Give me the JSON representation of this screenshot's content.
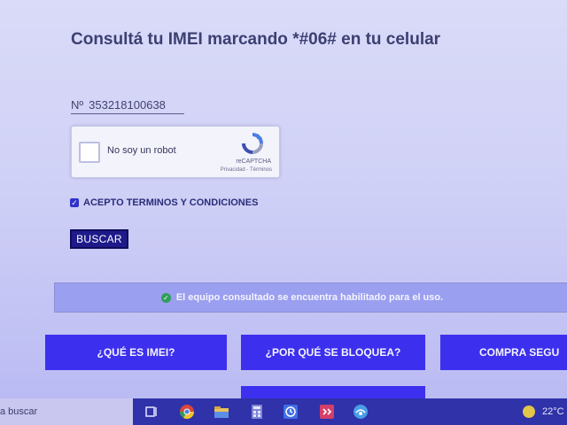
{
  "page": {
    "title": "Consultá tu IMEI marcando *#06# en tu celular"
  },
  "imei": {
    "prefix": "Nº",
    "value": "353218100638"
  },
  "captcha": {
    "label": "No soy un robot",
    "brand": "reCAPTCHA",
    "links": "Privacidad - Términos"
  },
  "terms": {
    "checked": true,
    "label": "ACEPTO TERMINOS Y CONDICIONES"
  },
  "search_button": {
    "label": "BUSCAR"
  },
  "status": {
    "text": "El equipo consultado se encuentra habilitado para el uso."
  },
  "info_buttons": [
    {
      "label": "¿QUÉ ES IMEI?"
    },
    {
      "label": "¿POR QUÉ SE BLOQUEA?"
    },
    {
      "label": "COMPRA SEGU"
    }
  ],
  "taskbar": {
    "search_text": "a buscar",
    "temperature": "22°C",
    "icons": [
      "task-view-icon",
      "chrome-icon",
      "file-explorer-icon",
      "calculator-icon",
      "clock-icon",
      "app-icon",
      "vpn-icon"
    ]
  },
  "colors": {
    "primary_button": "#3c2fee",
    "search_button": "#1e1a8a",
    "status_ok": "#2f9e5a",
    "taskbar": "#2f32a8"
  }
}
